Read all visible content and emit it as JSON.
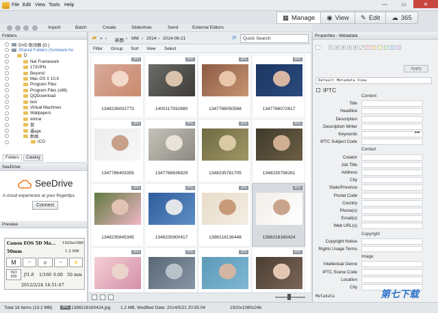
{
  "menu": [
    "File",
    "Edit",
    "View",
    "Tools",
    "Help"
  ],
  "mode_tabs": [
    {
      "label": "Manage",
      "icon": "grid-icon",
      "active": true
    },
    {
      "label": "View",
      "icon": "eye-icon"
    },
    {
      "label": "Edit",
      "icon": "pencil-icon"
    },
    {
      "label": "365",
      "icon": "cloud-365-icon"
    }
  ],
  "toolbar": [
    "Import",
    "Batch",
    "Create",
    "Slideshow",
    "Send",
    "External Editors"
  ],
  "folders": {
    "title": "Folders",
    "tree": [
      {
        "label": "DVD 驱动器 (D:)",
        "type": "drive"
      },
      {
        "label": "Shared Folders (\\\\vmware-ho",
        "type": "drive",
        "link": true
      },
      {
        "label": "D",
        "type": "folder"
      },
      {
        "label": "Net Framework",
        "type": "folder"
      },
      {
        "label": "173VPN",
        "type": "folder"
      },
      {
        "label": "Beyond",
        "type": "folder"
      },
      {
        "label": "Mac OS X 10.9",
        "type": "folder"
      },
      {
        "label": "Program Files",
        "type": "folder"
      },
      {
        "label": "Program Files (x86)",
        "type": "folder"
      },
      {
        "label": "QQDownload",
        "type": "folder"
      },
      {
        "label": "test",
        "type": "folder"
      },
      {
        "label": "Virtual Machines",
        "type": "folder"
      },
      {
        "label": "Wallpapers",
        "type": "folder"
      },
      {
        "label": "winrar",
        "type": "folder"
      },
      {
        "label": "鼠",
        "type": "folder"
      },
      {
        "label": "逼apk",
        "type": "folder"
      },
      {
        "label": "新图",
        "type": "folder"
      },
      {
        "label": "ICO",
        "type": "folder"
      }
    ],
    "tabs": [
      "Folders",
      "Catalog"
    ]
  },
  "seedrive": {
    "title": "SeeDrive",
    "logo": "SeeDrive",
    "tagline": "A cloud experience at your fingertips",
    "connect": "Connect"
  },
  "preview": {
    "title": "Preview",
    "camera": "Canon EOS 5D Ma...",
    "resolution": "1920x1080",
    "focal": "50mm",
    "size": "1.2 MB",
    "mode": "M",
    "dash1": "--",
    "dash2": "--",
    "iso_label": "ISO",
    "iso": "200",
    "aperture": "f/1.8",
    "shutter": "1/160",
    "ev": "0.00",
    "focal2": "50 mm",
    "datetime": "2012/2/24 14:51:47"
  },
  "path": [
    "新图",
    "MM",
    "2014",
    "2014-06-21"
  ],
  "quick_search": "Quick Search",
  "filterbar": [
    "Filter",
    "Group",
    "Sort",
    "View",
    "Select"
  ],
  "top_count": "6",
  "photos": [
    {
      "name": "1348236002773",
      "badge": "JPG",
      "colors": [
        "#d8a99a",
        "#f2d9c9",
        "#c98a6d"
      ]
    },
    {
      "name": "1400117932889",
      "badge": "JPG",
      "colors": [
        "#6b6c68",
        "#d9c3ac",
        "#3e3b38"
      ]
    },
    {
      "name": "1347786050568",
      "badge": "JPG",
      "colors": [
        "#8b5a43",
        "#e8c4a8",
        "#c79472"
      ]
    },
    {
      "name": "1347786072617",
      "badge": "JPG",
      "colors": [
        "#1b3560",
        "#d7b6a3",
        "#2a4b7e"
      ]
    },
    {
      "name": "1347786403355",
      "badge": "JPG",
      "colors": [
        "#ededed",
        "#c79f8b",
        "#f7f7f7"
      ]
    },
    {
      "name": "1347788636829",
      "badge": "JPG",
      "colors": [
        "#c5c2b9",
        "#eae3da",
        "#8c8a82"
      ]
    },
    {
      "name": "1348235781705",
      "badge": "JPG",
      "colors": [
        "#6f6a42",
        "#d9c9a5",
        "#a19766"
      ]
    },
    {
      "name": "1348235798261",
      "badge": "JPG",
      "colors": [
        "#3f3a2c",
        "#cfae92",
        "#6d5f45"
      ]
    },
    {
      "name": "1348235845345",
      "badge": "JPG",
      "colors": [
        "#5f7a3d",
        "#e2c2b3",
        "#f1b6c9"
      ]
    },
    {
      "name": "1348235900417",
      "badge": "JPG",
      "colors": [
        "#2e5c9b",
        "#e3e6e9",
        "#5f8fc6"
      ]
    },
    {
      "name": "1398218136448",
      "badge": "JPG",
      "colors": [
        "#e8dcc8",
        "#c99a7a",
        "#f3ede3"
      ]
    },
    {
      "name": "1398218160424",
      "badge": "JPG",
      "colors": [
        "#f2eee8",
        "#c9a48c",
        "#ffffff"
      ],
      "selected": true
    },
    {
      "name": "",
      "badge": "JPG",
      "colors": [
        "#f4cfd6",
        "#ead4cc",
        "#d48fa8"
      ]
    },
    {
      "name": "",
      "badge": "JPG",
      "colors": [
        "#5a6777",
        "#b9c1c9",
        "#8796a4"
      ]
    },
    {
      "name": "",
      "badge": "JPG",
      "colors": [
        "#5c9ab8",
        "#d4b4a2",
        "#7fb7d2"
      ]
    },
    {
      "name": "",
      "badge": "JPG",
      "colors": [
        "#4b3e33",
        "#e3c7b3",
        "#7b6658"
      ]
    }
  ],
  "metadata": {
    "title": "Properties - Metadata",
    "swatch_numbers": [
      "1",
      "2",
      "3",
      "4",
      "5"
    ],
    "swatch_colors": [
      "#ffd9d9",
      "#ffe7c4",
      "#f7f3c4",
      "#d4f2cf",
      "#cfe3f7",
      "#e5d6f2"
    ],
    "apply": "Apply",
    "view_select": "Default Metadata View",
    "section": "IPTC",
    "groups": [
      {
        "heading": "Content",
        "fields": [
          "Title",
          "Headline",
          "Description",
          "Description Writer",
          "Keywords",
          "IPTC Subject Code"
        ]
      },
      {
        "heading": "Contact",
        "fields": [
          "Creator",
          "Job Title",
          "Address",
          "City",
          "State/Province",
          "Postal Code",
          "Country",
          "Phone(s)",
          "Email(s)",
          "Web URL(s)"
        ]
      },
      {
        "heading": "Copyright",
        "fields": [
          "Copyright Notice",
          "Rights Usage Terms"
        ]
      },
      {
        "heading": "Image",
        "fields": [
          "Intellectual Genre",
          "IPTC Scene Code",
          "Location",
          "City"
        ]
      }
    ],
    "footer": "Metadata"
  },
  "status": {
    "total": "Total 18 items (13.2 MB)",
    "format": "JPG",
    "selected_name": "1398218160424.jpg",
    "details": "1.2 MB, Modified Date: 2014/5/21 20:55:04",
    "dims": "1920x1080x24b"
  },
  "watermark": "第七下载"
}
